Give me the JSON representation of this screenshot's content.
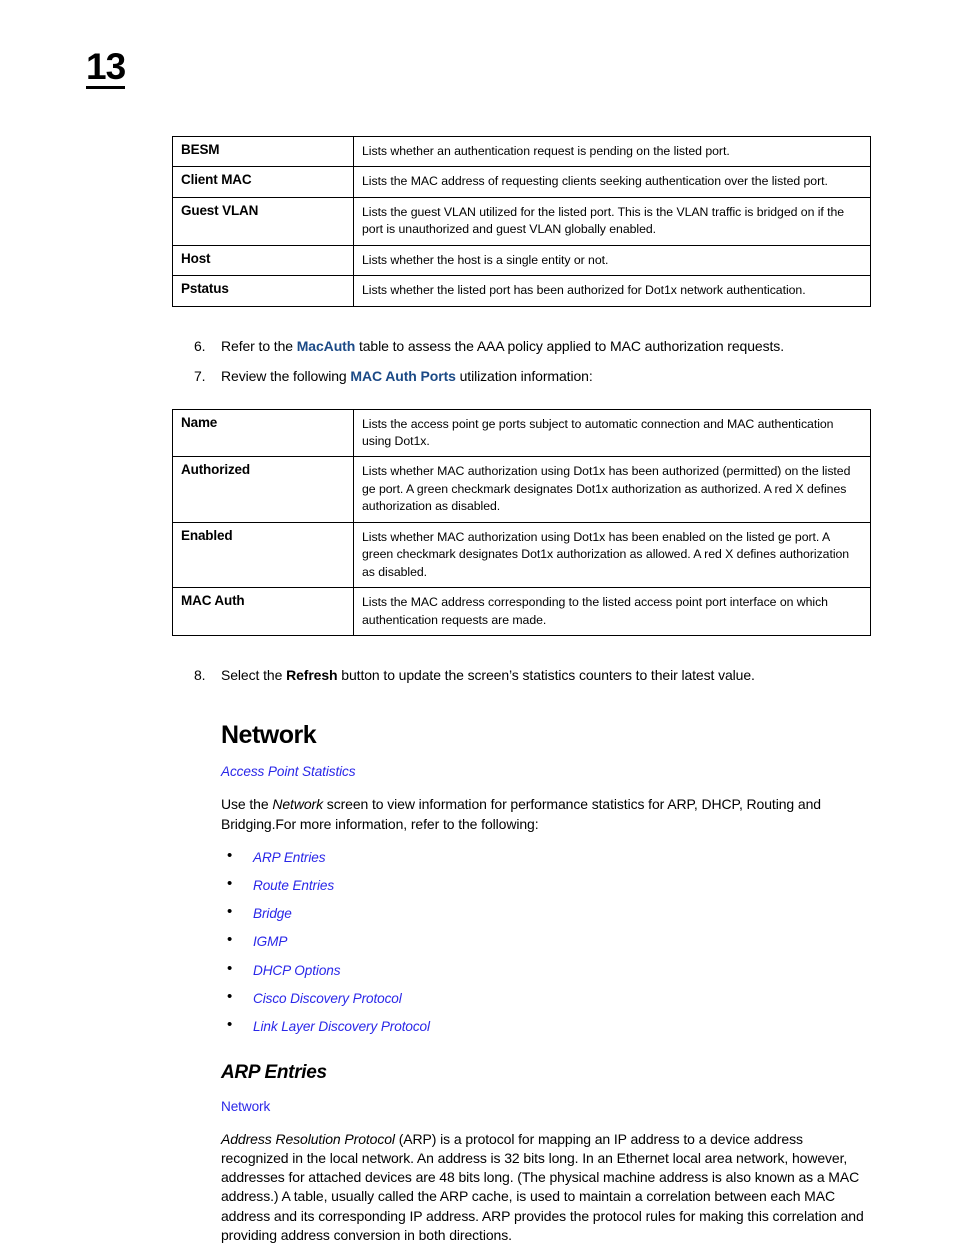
{
  "page": {
    "number": "13"
  },
  "table_one": {
    "rows": [
      {
        "term": "BESM",
        "desc": "Lists whether an authentication request is pending on the listed port."
      },
      {
        "term": "Client MAC",
        "desc": "Lists the MAC address of requesting clients seeking authentication over the listed port."
      },
      {
        "term": "Guest VLAN",
        "desc": "Lists the guest VLAN utilized for the listed port. This is the VLAN traffic is bridged on if the port is unauthorized and guest VLAN globally enabled."
      },
      {
        "term": "Host",
        "desc": "Lists whether the host is a single entity or not."
      },
      {
        "term": "Pstatus",
        "desc": "Lists whether the listed port has been authorized for Dot1x network authentication."
      }
    ]
  },
  "steps": {
    "step6": {
      "num": "6.",
      "pre": "Refer to the ",
      "link": "MacAuth",
      "post": " table to assess the AAA policy applied to MAC authorization requests."
    },
    "step7": {
      "num": "7.",
      "pre": "Review the following ",
      "link": "MAC Auth Ports",
      "post": " utilization information:"
    },
    "step8": {
      "num": "8.",
      "pre": "Select the ",
      "bold": "Refresh",
      "post": " button to update the screen’s statistics counters to their latest value."
    }
  },
  "table_two": {
    "rows": [
      {
        "term": "Name",
        "desc": "Lists the access point ge ports subject to automatic connection and MAC authentication using Dot1x."
      },
      {
        "term": "Authorized",
        "desc": "Lists whether MAC authorization using Dot1x has been authorized (permitted) on the listed ge port. A green checkmark designates Dot1x authorization as authorized. A red X defines authorization as disabled."
      },
      {
        "term": "Enabled",
        "desc": "Lists whether MAC authorization using Dot1x has been enabled on the listed ge port. A green checkmark designates Dot1x authorization as allowed. A red X defines authorization as disabled."
      },
      {
        "term": "MAC Auth",
        "desc": "Lists the MAC address corresponding to the listed access point port interface on which authentication requests are made."
      }
    ]
  },
  "network_section": {
    "heading": "Network",
    "breadcrumb_link": "Access Point Statistics",
    "intro_pre": "Use the ",
    "intro_italic": "Network",
    "intro_post": " screen to view information for performance statistics for ARP, DHCP, Routing and Bridging.For more information, refer to the following:",
    "bullet_marker": "•",
    "links": [
      "ARP Entries",
      "Route Entries",
      "Bridge",
      "IGMP",
      "DHCP Options",
      "Cisco Discovery Protocol",
      "Link Layer Discovery Protocol"
    ]
  },
  "arp_section": {
    "heading": "ARP Entries",
    "breadcrumb_link": "Network",
    "body_italic": "Address Resolution Protocol",
    "body_text": " (ARP) is a protocol for mapping an IP address to a device address recognized in the local network. An address is 32 bits long. In an Ethernet local area network, however, addresses for attached devices are 48 bits long. (The physical machine address is also known as a MAC address.) A table, usually called the ARP cache, is used to maintain a correlation between each MAC address and its corresponding IP address. ARP provides the protocol rules for making this correlation and providing address conversion in both directions."
  },
  "colors": {
    "xref_bright": "#2a27e8",
    "xref_dark": "#1b4a86",
    "text": "#000000",
    "border": "#000000"
  }
}
